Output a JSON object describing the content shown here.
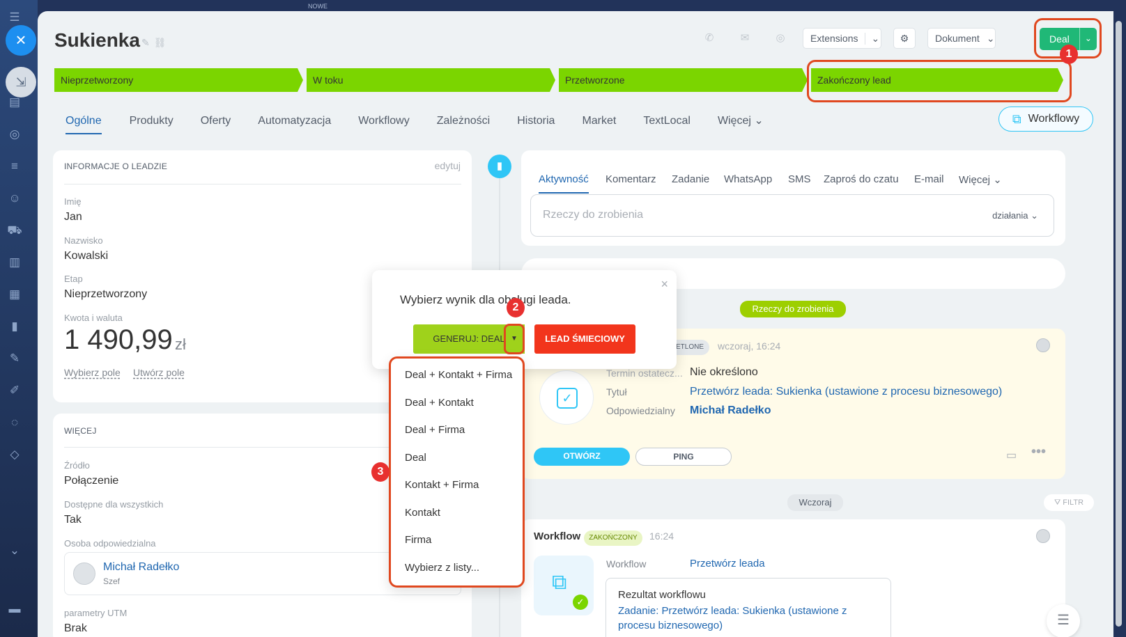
{
  "browser": {
    "top_tab": "NOWE"
  },
  "header": {
    "title": "Sukienka",
    "extensions_label": "Extensions",
    "dokument_label": "Dokument",
    "deal_label": "Deal"
  },
  "stages": [
    "Nieprzetworzony",
    "W toku",
    "Przetworzone",
    "Zakończony lead"
  ],
  "tabs": [
    "Ogólne",
    "Produkty",
    "Oferty",
    "Automatyzacja",
    "Workflowy",
    "Zależności",
    "Historia",
    "Market",
    "TextLocal",
    "Więcej"
  ],
  "workflow_button": "Workflowy",
  "lead_info": {
    "title": "INFORMACJE O LEADZIE",
    "edit": "edytuj",
    "fields": [
      {
        "label": "Imię",
        "value": "Jan"
      },
      {
        "label": "Nazwisko",
        "value": "Kowalski"
      },
      {
        "label": "Etap",
        "value": "Nieprzetworzony"
      }
    ],
    "amount_label": "Kwota i waluta",
    "amount": "1 490,99",
    "currency": "zł",
    "choose_field": "Wybierz pole",
    "create_field": "Utwórz pole"
  },
  "more": {
    "title": "WIĘCEJ",
    "source_label": "Źródło",
    "source": "Połączenie",
    "available_label": "Dostępne dla wszystkich",
    "available": "Tak",
    "responsible_label": "Osoba odpowiedzialna",
    "responsible_name": "Michał Radełko",
    "responsible_role": "Szef",
    "utm_label": "parametry UTM",
    "utm": "Brak"
  },
  "activity_tabs": [
    "Aktywność",
    "Komentarz",
    "Zadanie",
    "WhatsApp",
    "SMS",
    "Zaproś do czatu",
    "E-mail",
    "Więcej"
  ],
  "todo": {
    "placeholder": "Rzeczy do zrobienia",
    "actions": "działania"
  },
  "timeline": {
    "todo_badge": "Rzeczy do zrobienia",
    "task": {
      "status": "ETLONE",
      "time": "wczoraj, 16:24",
      "deadline_label": "Termin ostatecz...",
      "deadline": "Nie określono",
      "title_label": "Tytuł",
      "title": "Przetwórz leada: Sukienka (ustawione z procesu biznesowego)",
      "resp_label": "Odpowiedzialny",
      "resp": "Michał Radełko",
      "open": "OTWÓRZ",
      "ping": "PING"
    },
    "yesterday": "Wczoraj",
    "filter": "FILTR",
    "workflow": {
      "title": "Workflow",
      "status": "ZAKOŃCZONY",
      "time": "16:24",
      "label": "Workflow",
      "value": "Przetwórz leada",
      "result_label": "Rezultat workflowu",
      "result_text": "Zadanie: Przetwórz leada: Sukienka  (ustawione z procesu biznesowego)"
    }
  },
  "popup": {
    "text": "Wybierz wynik dla obsługi leada.",
    "generate": "GENERUJ: DEAL",
    "junk": "LEAD ŚMIECIOWY"
  },
  "dropdown": [
    "Deal + Kontakt + Firma",
    "Deal + Kontakt",
    "Deal + Firma",
    "Deal",
    "Kontakt + Firma",
    "Kontakt",
    "Firma",
    "Wybierz z listy..."
  ],
  "markers": [
    "1",
    "2",
    "3"
  ],
  "colors": {
    "stage": "#7bd500",
    "accent": "#2067b0",
    "deal": "#20b877",
    "junk": "#f2351c",
    "highlight": "#e0481f"
  }
}
